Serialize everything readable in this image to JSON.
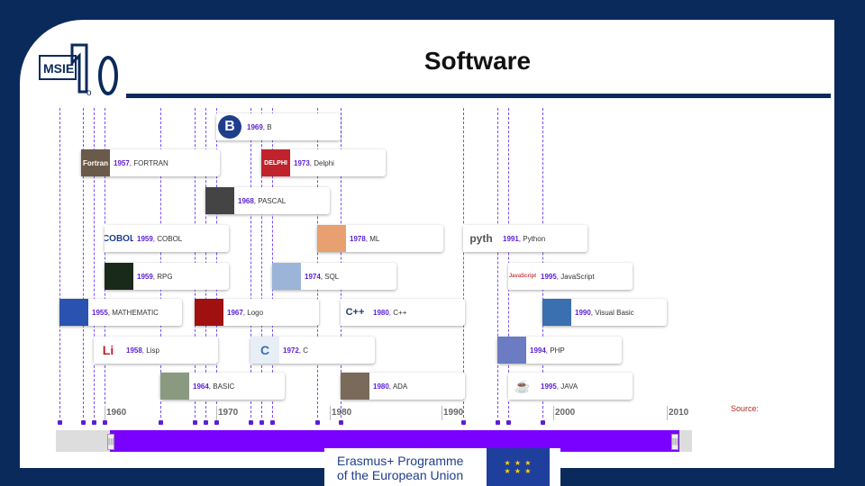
{
  "slide": {
    "title": "Software",
    "source_label": "Source:"
  },
  "logo": {
    "text": "MSIE",
    "number": "4.0"
  },
  "footer": {
    "line1": "Erasmus+ Programme",
    "line2": "of the European Union"
  },
  "colors": {
    "navy": "#0b2a5c",
    "accent": "#5b1fd6",
    "scroll": "#7a00ff"
  },
  "timeline": {
    "axis_labels": [
      "1960",
      "1970",
      "1980",
      "1990",
      "2000",
      "2010"
    ],
    "events": [
      {
        "year": "1969",
        "name": "B"
      },
      {
        "year": "1957",
        "name": "FORTRAN"
      },
      {
        "year": "1973",
        "name": "Delphi"
      },
      {
        "year": "1968",
        "name": "PASCAL"
      },
      {
        "year": "1959",
        "name": "COBOL"
      },
      {
        "year": "1978",
        "name": "ML"
      },
      {
        "year": "1991",
        "name": "Python"
      },
      {
        "year": "1959",
        "name": "RPG"
      },
      {
        "year": "1974",
        "name": "SQL"
      },
      {
        "year": "1995",
        "name": "JavaScript"
      },
      {
        "year": "1955",
        "name": "MATHEMATIC"
      },
      {
        "year": "1967",
        "name": "Logo"
      },
      {
        "year": "1980",
        "name": "C++"
      },
      {
        "year": "1990",
        "name": "Visual Basic"
      },
      {
        "year": "1958",
        "name": "Lisp"
      },
      {
        "year": "1972",
        "name": "C"
      },
      {
        "year": "1994",
        "name": "PHP"
      },
      {
        "year": "1964",
        "name": "BASIC"
      },
      {
        "year": "1980",
        "name": "ADA"
      },
      {
        "year": "1995",
        "name": "JAVA"
      }
    ],
    "thumb_text": {
      "b": "B",
      "fortran": "Fortran",
      "delphi": "DELPHI",
      "cobol": "COBOL",
      "python": "pyth",
      "js": "JavaScript",
      "cpp": "C++",
      "lisp": "Li",
      "c": "C"
    }
  }
}
